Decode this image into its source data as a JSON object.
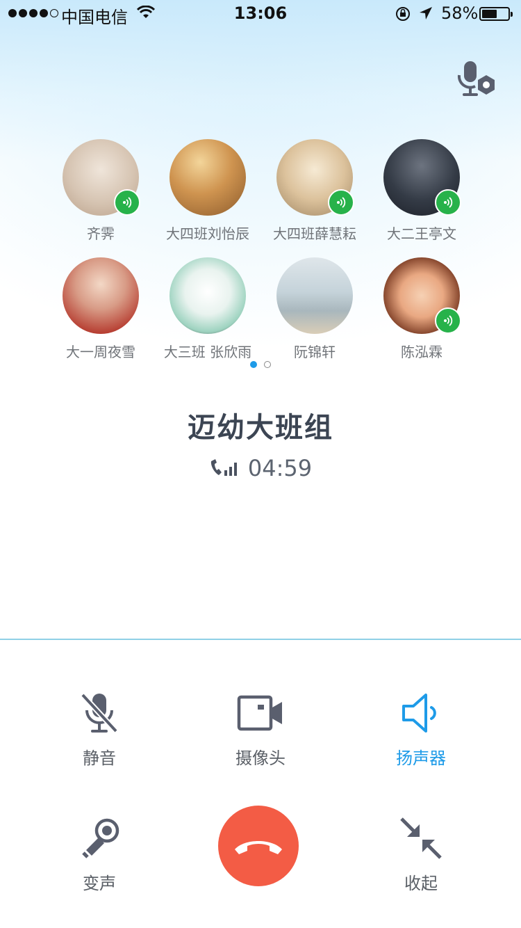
{
  "status_bar": {
    "carrier": "中国电信",
    "time": "13:06",
    "battery_percent": "58%",
    "battery_level": 0.58
  },
  "call": {
    "group_name": "迈幼大班组",
    "duration": "04:59"
  },
  "participants": [
    {
      "name": "齐霁",
      "speaking": true,
      "avatar_color": "#d9c9b8"
    },
    {
      "name": "大四班刘怡辰",
      "speaking": false,
      "avatar_color": "#c98a3e"
    },
    {
      "name": "大四班薛慧耘",
      "speaking": true,
      "avatar_color": "#d8c4a2"
    },
    {
      "name": "大二王亭文",
      "speaking": true,
      "avatar_color": "#2c333d"
    },
    {
      "name": "大一周夜雪",
      "speaking": false,
      "avatar_color": "#c96b5f"
    },
    {
      "name": "大三班 张欣雨",
      "speaking": false,
      "avatar_color": "#a8d8c8"
    },
    {
      "name": "阮锦轩",
      "speaking": false,
      "avatar_color": "#b9c7cf"
    },
    {
      "name": "陈泓霖",
      "speaking": true,
      "avatar_color": "#e7b38f"
    }
  ],
  "pager": {
    "pages": 2,
    "current": 1
  },
  "controls": {
    "mute": "静音",
    "camera": "摄像头",
    "speaker": "扬声器",
    "voice_change": "变声",
    "collapse": "收起"
  },
  "colors": {
    "accent": "#1e9be8",
    "speaking": "#27b24a",
    "hangup": "#f35c45",
    "icon": "#5a5f6e"
  }
}
